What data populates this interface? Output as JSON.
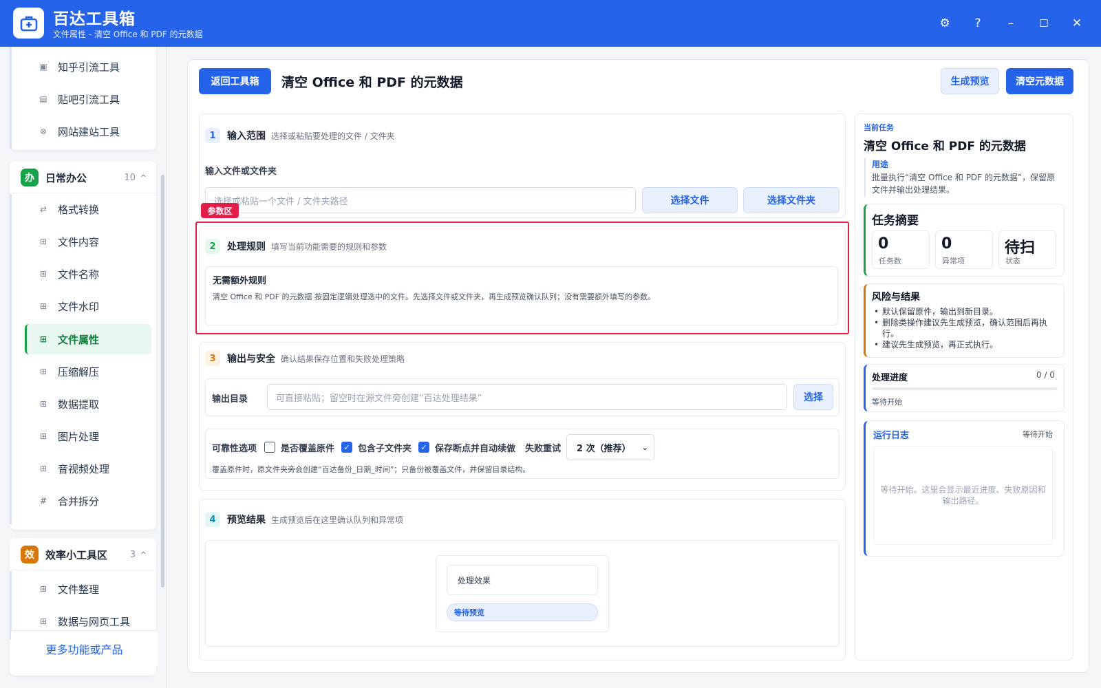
{
  "app": {
    "title": "百达工具箱",
    "subtitle": "文件属性 - 清空 Office 和 PDF 的元数据",
    "controls": {
      "settings": "⚙",
      "help": "?",
      "minimize": "–",
      "maximize": "☐",
      "close": "✕"
    }
  },
  "sidebar": {
    "top_items": [
      {
        "label": "知乎引流工具",
        "icon": "box-icon"
      },
      {
        "label": "贴吧引流工具",
        "icon": "chat-icon"
      },
      {
        "label": "网站建站工具",
        "icon": "globe-icon"
      }
    ],
    "groups": [
      {
        "badge": "办",
        "badge_color": "#16a34a",
        "name": "日常办公",
        "count": "10",
        "caret": "^",
        "items": [
          {
            "label": "格式转换",
            "icon": "swap-icon",
            "glyph": "⇄"
          },
          {
            "label": "文件内容",
            "icon": "grid-icon",
            "glyph": "⊞"
          },
          {
            "label": "文件名称",
            "icon": "grid-icon",
            "glyph": "⊞"
          },
          {
            "label": "文件水印",
            "icon": "grid-icon",
            "glyph": "⊞"
          },
          {
            "label": "文件属性",
            "icon": "grid-icon",
            "glyph": "⊞",
            "active": true
          },
          {
            "label": "压缩解压",
            "icon": "grid-icon",
            "glyph": "⊞"
          },
          {
            "label": "数据提取",
            "icon": "grid-icon",
            "glyph": "⊞"
          },
          {
            "label": "图片处理",
            "icon": "grid-icon",
            "glyph": "⊞"
          },
          {
            "label": "音视频处理",
            "icon": "grid-icon",
            "glyph": "⊞"
          },
          {
            "label": "合并拆分",
            "icon": "hash-icon",
            "glyph": "#"
          }
        ]
      },
      {
        "badge": "效",
        "badge_color": "#d97706",
        "name": "效率小工具区",
        "count": "3",
        "caret": "^",
        "items": [
          {
            "label": "文件整理",
            "icon": "grid-icon",
            "glyph": "⊞"
          },
          {
            "label": "数据与网页工具",
            "icon": "grid-icon",
            "glyph": "⊞"
          }
        ]
      }
    ],
    "footer": "更多功能或产品"
  },
  "header": {
    "back_button": "返回工具箱",
    "title": "清空 Office 和 PDF 的元数据",
    "preview_button": "生成预览",
    "run_button": "清空元数据"
  },
  "sections": {
    "input": {
      "num": "1",
      "title": "输入范围",
      "desc": "选择或粘贴要处理的文件 / 文件夹",
      "field_label": "输入文件或文件夹",
      "placeholder": "选择或粘贴一个文件 / 文件夹路径",
      "select_file": "选择文件",
      "select_folder": "选择文件夹"
    },
    "param_tag": "参数区",
    "rules": {
      "num": "2",
      "title": "处理规则",
      "desc": "填写当前功能需要的规则和参数",
      "box_title": "无需额外规则",
      "box_text": "清空 Office 和 PDF 的元数据 按固定逻辑处理选中的文件。先选择文件或文件夹，再生成预览确认队列；没有需要额外填写的参数。"
    },
    "output": {
      "num": "3",
      "title": "输出与安全",
      "desc": "确认结果保存位置和失败处理策略",
      "dir_label": "输出目录",
      "dir_placeholder": "可直接粘贴；留空时在源文件旁创建“百达处理结果”",
      "dir_button": "选择",
      "reliability_label": "可靠性选项",
      "overwrite_label": "是否覆盖原件",
      "overwrite_checked": false,
      "subfolder_label": "包含子文件夹",
      "subfolder_checked": true,
      "resume_label": "保存断点并自动续做",
      "resume_checked": true,
      "retry_label": "失败重试",
      "retry_value": "2 次（推荐）",
      "note": "覆盖原件时，原文件夹旁会创建“百达备份_日期_时间”；只备份被覆盖文件，并保留目录结构。"
    },
    "preview": {
      "num": "4",
      "title": "预览结果",
      "desc": "生成预览后在这里确认队列和异常项",
      "effect_label": "处理效果",
      "status": "等待预览"
    }
  },
  "right": {
    "current_task_label": "当前任务",
    "task_title": "清空 Office 和 PDF 的元数据",
    "usage_label": "用途",
    "usage_text": "批量执行“清空 Office 和 PDF 的元数据”，保留原文件并输出处理结果。",
    "summary_title": "任务摘要",
    "stats": [
      {
        "value": "0",
        "label": "任务数"
      },
      {
        "value": "0",
        "label": "异常项"
      },
      {
        "value": "待扫",
        "label": "状态"
      }
    ],
    "risk_title": "风险与结果",
    "risks": [
      "默认保留原件，输出到新目录。",
      "删除类操作建议先生成预览，确认范围后再执行。",
      "建议先生成预览，再正式执行。"
    ],
    "progress_title": "处理进度",
    "progress_count": "0 / 0",
    "progress_fraction": 0,
    "progress_status": "等待开始",
    "log_title": "运行日志",
    "log_status": "等待开始",
    "log_placeholder": "等待开始。这里会显示最近进度、失败原因和输出路径。"
  },
  "colors": {
    "primary": "#2563eb",
    "active_green": "#16a34a",
    "warning_orange": "#d97706",
    "highlight_red": "#e11d48"
  }
}
